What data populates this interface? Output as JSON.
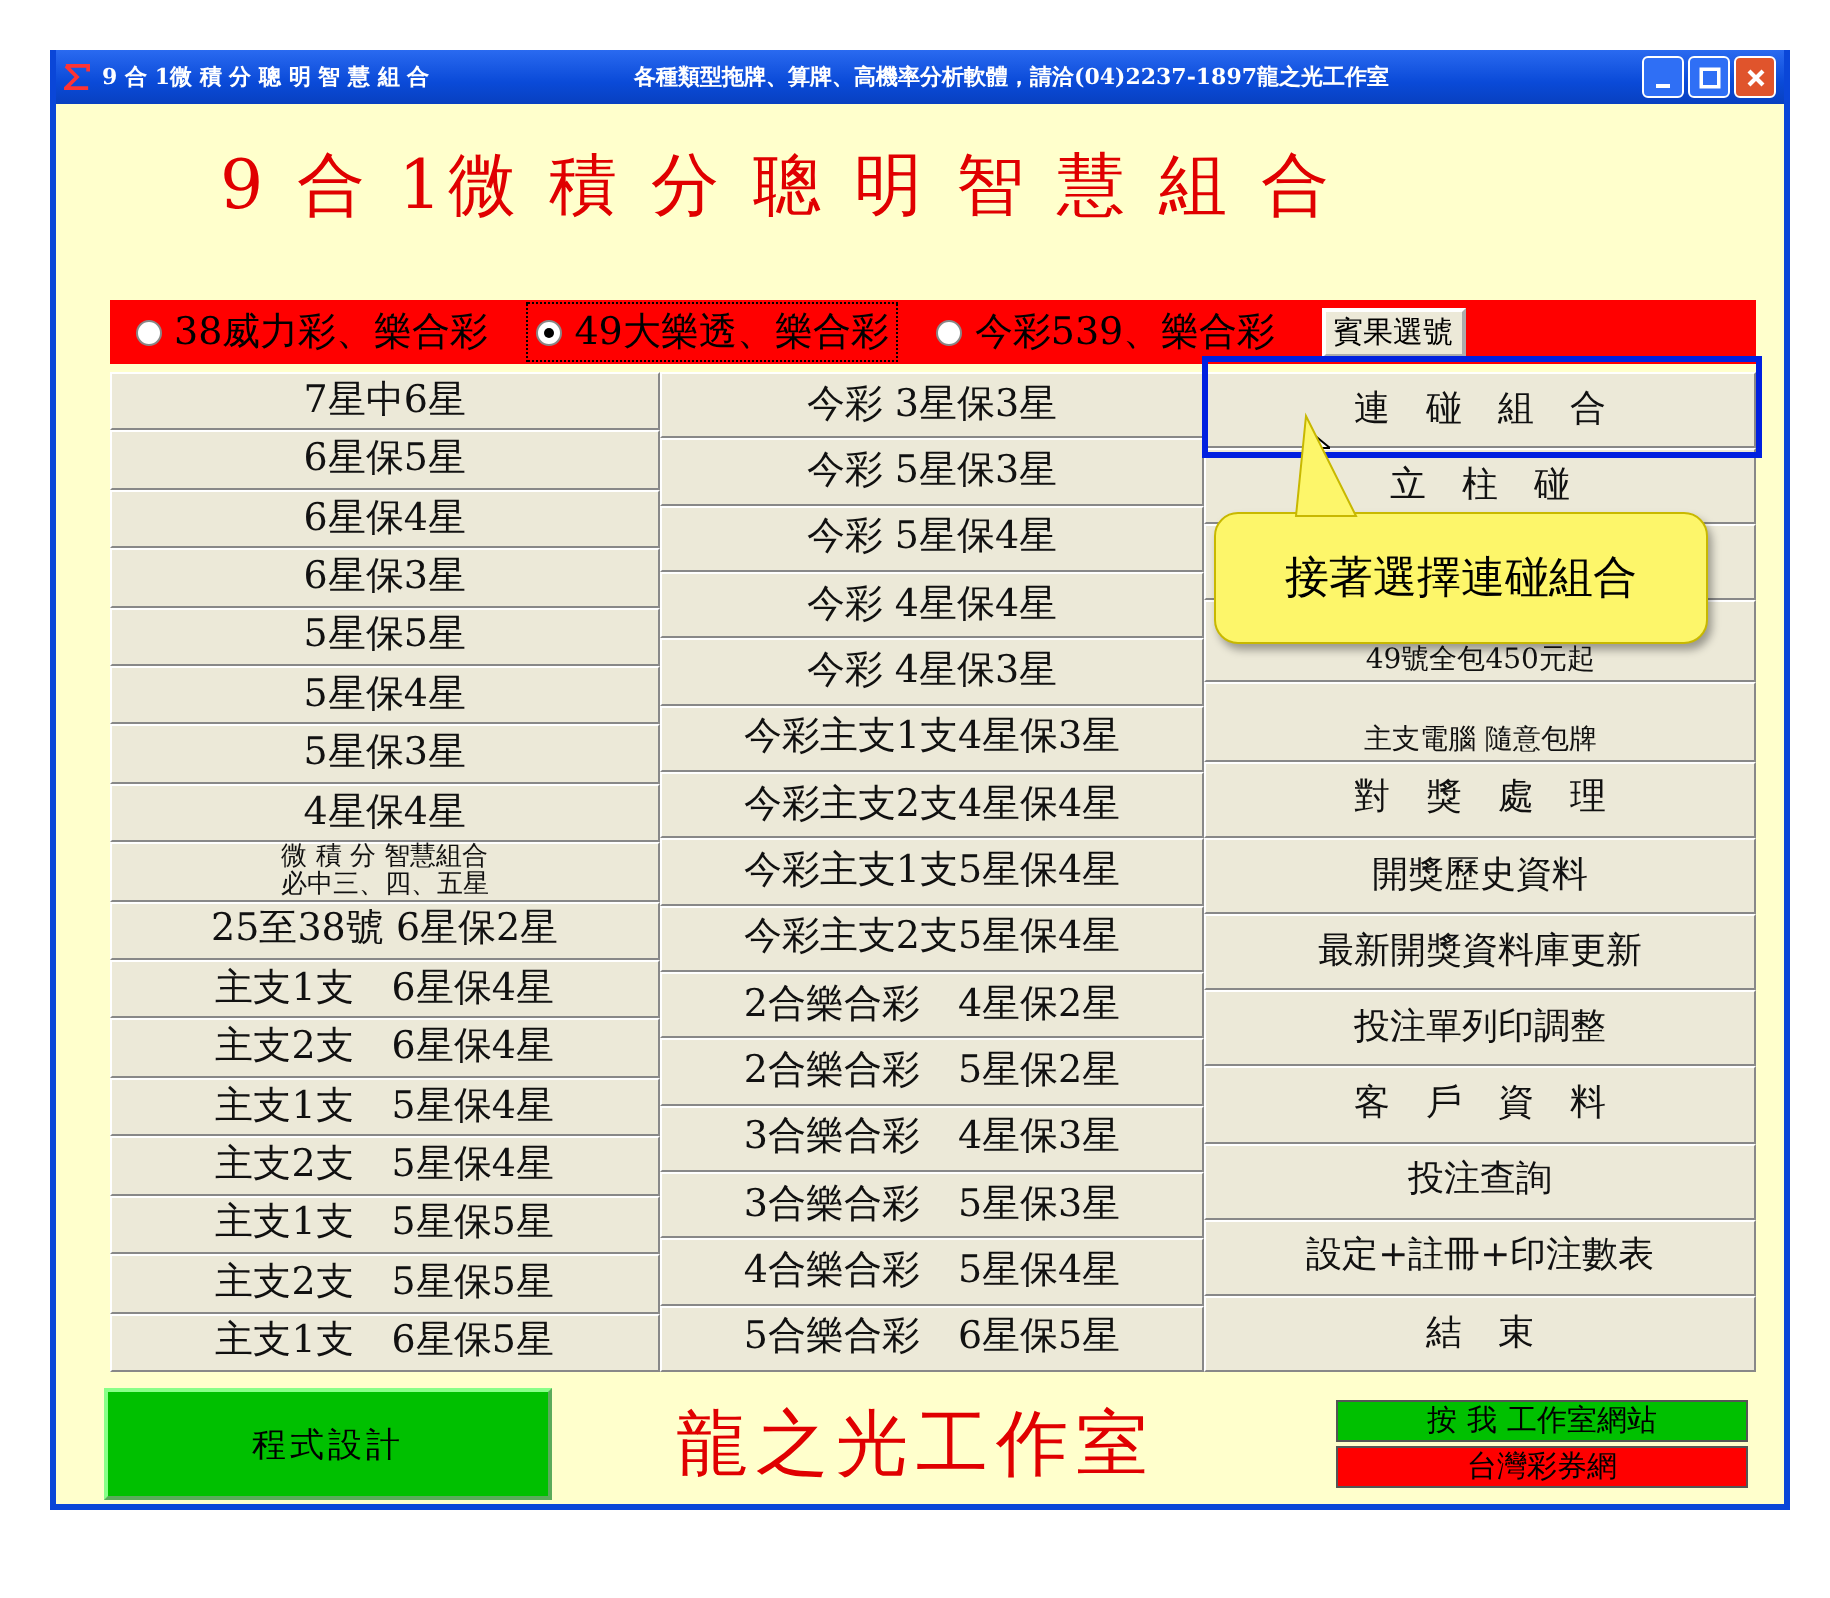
{
  "window": {
    "title": "9 合 1微 積 分 聰 明 智 慧 組 合",
    "caption": "各種類型拖牌、算牌、高機率分析軟體，請洽(04)2237-1897龍之光工作室"
  },
  "heading": "9 合 1微 積 分 聰 明 智 慧 組 合",
  "games": [
    {
      "label": "38威力彩、樂合彩",
      "selected": false
    },
    {
      "label": "49大樂透、樂合彩",
      "selected": true
    },
    {
      "label": "今彩539、樂合彩",
      "selected": false
    }
  ],
  "bingo_button": "賓果選號",
  "columns": [
    [
      {
        "lines": [
          "7星中6星"
        ]
      },
      {
        "lines": [
          "6星保5星"
        ]
      },
      {
        "lines": [
          "6星保4星"
        ]
      },
      {
        "lines": [
          "6星保3星"
        ]
      },
      {
        "lines": [
          "5星保5星"
        ]
      },
      {
        "lines": [
          "5星保4星"
        ]
      },
      {
        "lines": [
          "5星保3星"
        ]
      },
      {
        "lines": [
          "4星保4星"
        ]
      },
      {
        "kind": "small",
        "lines": [
          "微 積 分 智慧組合",
          "必中三、四、五星"
        ]
      },
      {
        "lines": [
          "25至38號 6星保2星"
        ]
      },
      {
        "lines": [
          "主支1支　6星保4星"
        ]
      },
      {
        "lines": [
          "主支2支　6星保4星"
        ]
      },
      {
        "lines": [
          "主支1支　5星保4星"
        ]
      },
      {
        "lines": [
          "主支2支　5星保4星"
        ]
      },
      {
        "lines": [
          "主支1支　5星保5星"
        ]
      },
      {
        "lines": [
          "主支2支　5星保5星"
        ]
      },
      {
        "lines": [
          "主支1支　6星保5星"
        ]
      }
    ],
    [
      {
        "lines": [
          "今彩 3星保3星"
        ]
      },
      {
        "lines": [
          "今彩 5星保3星"
        ]
      },
      {
        "lines": [
          "今彩 5星保4星"
        ]
      },
      {
        "lines": [
          "今彩 4星保4星"
        ]
      },
      {
        "lines": [
          "今彩 4星保3星"
        ]
      },
      {
        "lines": [
          "今彩主支1支4星保3星"
        ]
      },
      {
        "lines": [
          "今彩主支2支4星保4星"
        ]
      },
      {
        "lines": [
          "今彩主支1支5星保4星"
        ]
      },
      {
        "lines": [
          "今彩主支2支5星保4星"
        ]
      },
      {
        "lines": [
          "2合樂合彩　4星保2星"
        ]
      },
      {
        "lines": [
          "2合樂合彩　5星保2星"
        ]
      },
      {
        "lines": [
          "3合樂合彩　4星保3星"
        ]
      },
      {
        "lines": [
          "3合樂合彩　5星保3星"
        ]
      },
      {
        "lines": [
          "4合樂合彩　5星保4星"
        ]
      },
      {
        "lines": [
          "5合樂合彩　6星保5星"
        ]
      }
    ],
    [
      {
        "lines": [
          "連　碰　組　合"
        ]
      },
      {
        "lines": [
          "立　柱　碰"
        ]
      },
      {
        "kind": "blank"
      },
      {
        "kind": "small",
        "lines": [
          "49號全包450元起"
        ]
      },
      {
        "kind": "small",
        "lines": [
          "主支電腦 隨意包牌"
        ]
      },
      {
        "lines": [
          "對　獎　處　理"
        ]
      },
      {
        "lines": [
          "開獎歷史資料"
        ]
      },
      {
        "lines": [
          "最新開獎資料庫更新"
        ]
      },
      {
        "lines": [
          "投注單列印調整"
        ]
      },
      {
        "lines": [
          "客　戶　資　料"
        ]
      },
      {
        "lines": [
          "投注查詢"
        ]
      },
      {
        "lines": [
          "設定+註冊+印注數表"
        ]
      },
      {
        "lines": [
          "結　束"
        ]
      }
    ]
  ],
  "callout": "接著選擇連碰組合",
  "footer": {
    "design_button": "程式設計",
    "studio": "龍之光工作室",
    "links": [
      {
        "label": "按 我 工作室網站",
        "color": "#00c000"
      },
      {
        "label": "台灣彩券網",
        "color": "#ff0000"
      }
    ]
  }
}
